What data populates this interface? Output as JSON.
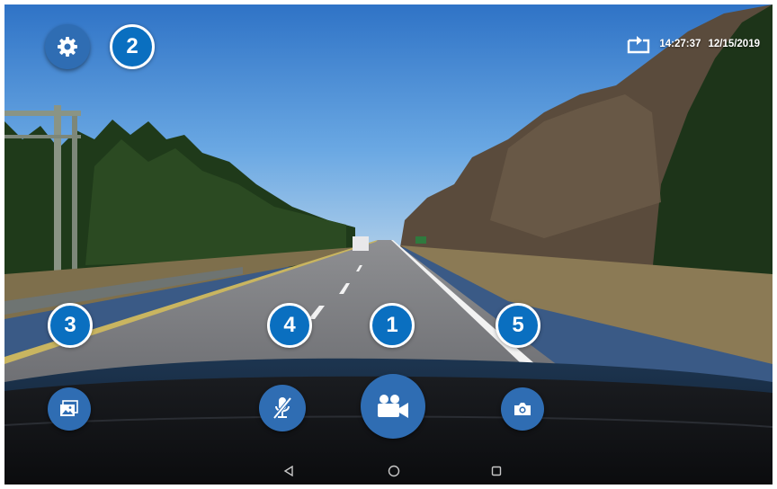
{
  "status_bar": {
    "time": "14:27:37",
    "date": "12/15/2019",
    "rotate_icon": "rotate-screen-icon"
  },
  "controls": {
    "settings_icon": "gear-icon",
    "gallery_icon": "gallery-icon",
    "mic_icon": "mic-muted-icon",
    "record_icon": "video-camera-icon",
    "snapshot_icon": "camera-icon"
  },
  "callouts": {
    "one": "1",
    "two": "2",
    "three": "3",
    "four": "4",
    "five": "5"
  },
  "navigation": {
    "back_icon": "back-triangle-icon",
    "home_icon": "home-circle-icon",
    "recents_icon": "recents-square-icon"
  },
  "colors": {
    "button_blue": "#2f6db3",
    "callout_blue": "#0a6fc0"
  }
}
